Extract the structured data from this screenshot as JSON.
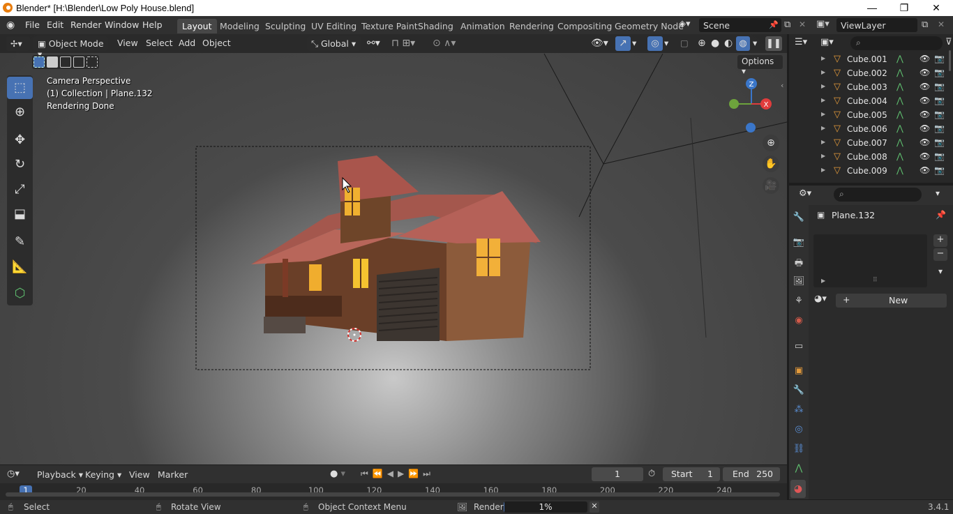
{
  "window": {
    "title": "Blender* [H:\\Blender\\Low Poly House.blend]",
    "minimize": "—",
    "maximize": "❐",
    "close": "✕"
  },
  "menu": {
    "items": [
      "File",
      "Edit",
      "Render",
      "Window",
      "Help"
    ]
  },
  "workspaces": {
    "tabs": [
      "Layout",
      "Modeling",
      "Sculpting",
      "UV Editing",
      "Texture Paint",
      "Shading",
      "Animation",
      "Rendering",
      "Compositing",
      "Geometry Node"
    ],
    "active": "Layout"
  },
  "scene": {
    "name": "Scene"
  },
  "view_layer": {
    "name": "ViewLayer"
  },
  "viewport_header": {
    "mode": "Object Mode",
    "menus": [
      "View",
      "Select",
      "Add",
      "Object"
    ],
    "transform_orientation": "Global",
    "options_label": "Options"
  },
  "viewport_overlay": {
    "line1": "Camera Perspective",
    "line2": "(1) Collection | Plane.132",
    "line3": "Rendering Done"
  },
  "gizmo": {
    "z": "Z",
    "x": "X"
  },
  "outliner": {
    "items": [
      "Cube.001",
      "Cube.002",
      "Cube.003",
      "Cube.004",
      "Cube.005",
      "Cube.006",
      "Cube.007",
      "Cube.008",
      "Cube.009"
    ]
  },
  "properties": {
    "object_name": "Plane.132",
    "new_button": "New",
    "plus": "+",
    "minus": "−"
  },
  "timeline": {
    "menus": [
      "Playback",
      "Keying",
      "View",
      "Marker"
    ],
    "current_frame": "1",
    "start_label": "Start",
    "start_value": "1",
    "end_label": "End",
    "end_value": "250",
    "ruler_ticks": [
      "1",
      "20",
      "40",
      "60",
      "80",
      "100",
      "120",
      "140",
      "160",
      "180",
      "200",
      "220",
      "240"
    ]
  },
  "statusbar": {
    "select": "Select",
    "rotate": "Rotate View",
    "context_menu": "Object Context Menu",
    "render_label": "Render",
    "render_progress": "1%",
    "render_progress_fraction": 0.01,
    "version": "3.4.1"
  },
  "colors": {
    "accent": "#4772b3",
    "axis_x": "#e03c3c",
    "axis_y": "#6da33c",
    "axis_z": "#3a76c9",
    "object_orange": "#e39a3b"
  }
}
